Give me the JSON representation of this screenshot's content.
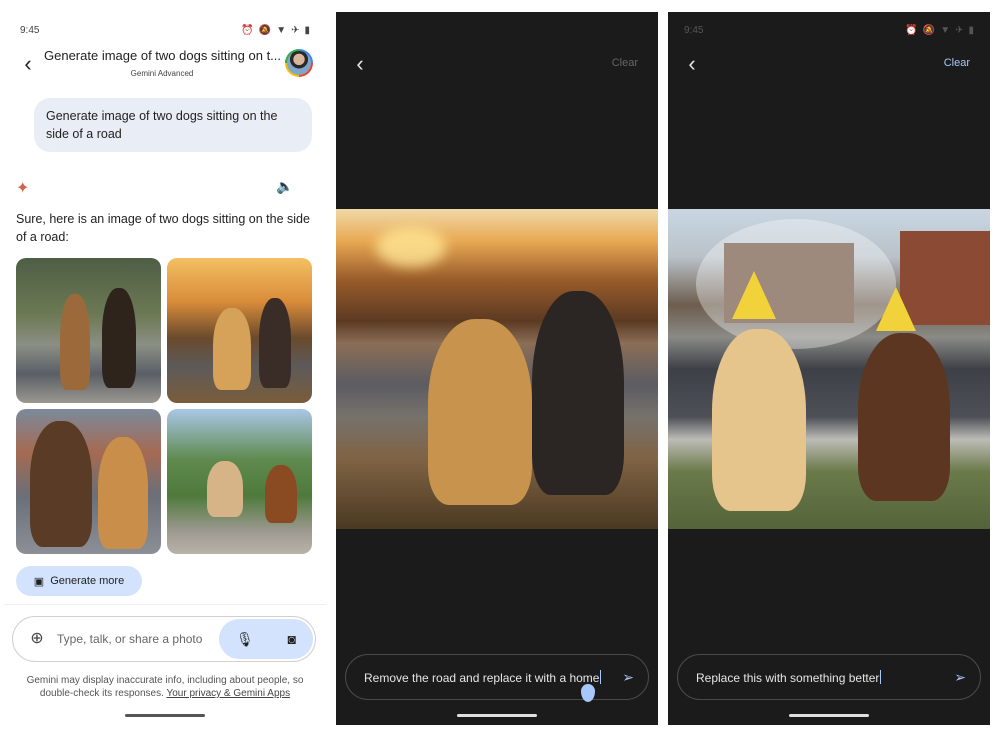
{
  "panel1": {
    "status_time": "9:45",
    "status_icons": [
      "alarm-icon",
      "mute-icon",
      "wifi-icon",
      "airplane-icon",
      "battery-icon"
    ],
    "header_title": "Generate image of two dogs sitting on t...",
    "header_subtitle": "Gemini Advanced",
    "user_message": "Generate image of two dogs sitting on the side of a road",
    "response_text": "Sure, here is an image of two dogs sitting on the side of a road:",
    "generate_more_label": "Generate more",
    "input_placeholder": "Type, talk, or share a photo",
    "disclaimer_text": "Gemini may display inaccurate info, including about people, so double-check its responses.",
    "disclaimer_link": "Your privacy & Gemini Apps"
  },
  "panel2": {
    "clear_label": "Clear",
    "prompt_text": "Remove the road and replace it with a home"
  },
  "panel3": {
    "status_time": "9:45",
    "clear_label": "Clear",
    "prompt_text": "Replace this with something better"
  },
  "colors": {
    "accent": "#a8c7fa",
    "chip_bg": "#d3e3fd",
    "bubble_bg": "#e9eef6",
    "gemini_spark": "#d5604d",
    "dark_bg": "#1b1b1b"
  }
}
